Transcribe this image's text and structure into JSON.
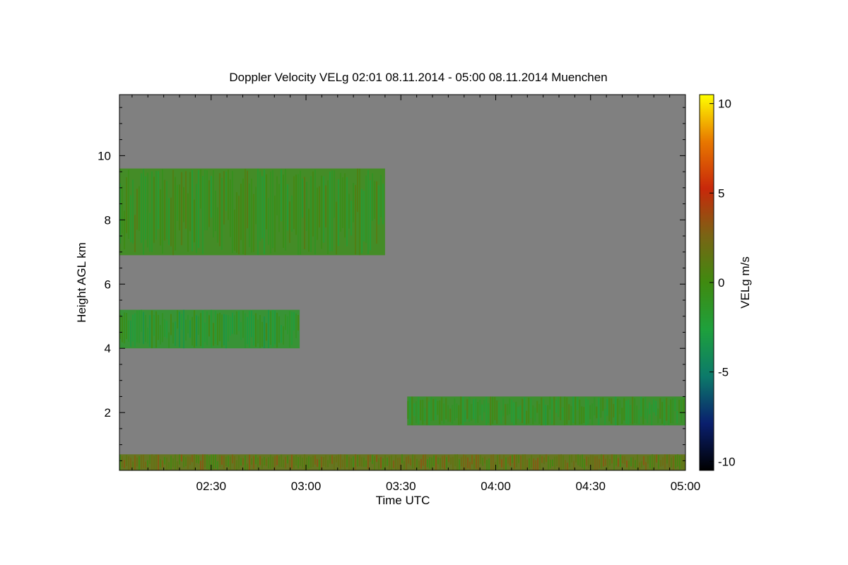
{
  "chart_data": {
    "type": "heatmap",
    "title": "Doppler Velocity VELg   02:01 08.11.2014 - 05:00 08.11.2014 Muenchen",
    "xlabel": "Time UTC",
    "ylabel": "Height AGL km",
    "colorbar_label": "VELg m/s",
    "x_range": [
      "02:01",
      "05:00"
    ],
    "x_ticks": [
      "02:30",
      "03:00",
      "03:30",
      "04:00",
      "04:30",
      "05:00"
    ],
    "y_range": [
      0.2,
      11.9
    ],
    "y_ticks": [
      2,
      4,
      6,
      8,
      10
    ],
    "color_range": [
      -10.5,
      10.5
    ],
    "color_ticks": [
      10,
      5,
      0,
      -5,
      -10
    ],
    "colormap": [
      "#000000",
      "#0a1f6e",
      "#0c7a6a",
      "#1ea03c",
      "#3f8a10",
      "#7a6414",
      "#c8280a",
      "#e87800",
      "#ffff00"
    ],
    "background_value_color": "#808080",
    "features": [
      {
        "name": "upper cloud layer",
        "t_start": "02:01",
        "t_end": "03:25",
        "h_min": 6.9,
        "h_max": 9.6,
        "velocity_ms": -0.5
      },
      {
        "name": "mid cloud layer",
        "t_start": "02:01",
        "t_end": "02:58",
        "h_min": 4.0,
        "h_max": 5.2,
        "velocity_ms": -1.5
      },
      {
        "name": "low cloud layer",
        "t_start": "03:32",
        "t_end": "05:00",
        "h_min": 1.6,
        "h_max": 2.5,
        "velocity_ms": -1.0
      },
      {
        "name": "near-surface layer",
        "t_start": "02:01",
        "t_end": "05:00",
        "h_min": 0.2,
        "h_max": 0.7,
        "velocity_ms": 1.5
      }
    ]
  }
}
